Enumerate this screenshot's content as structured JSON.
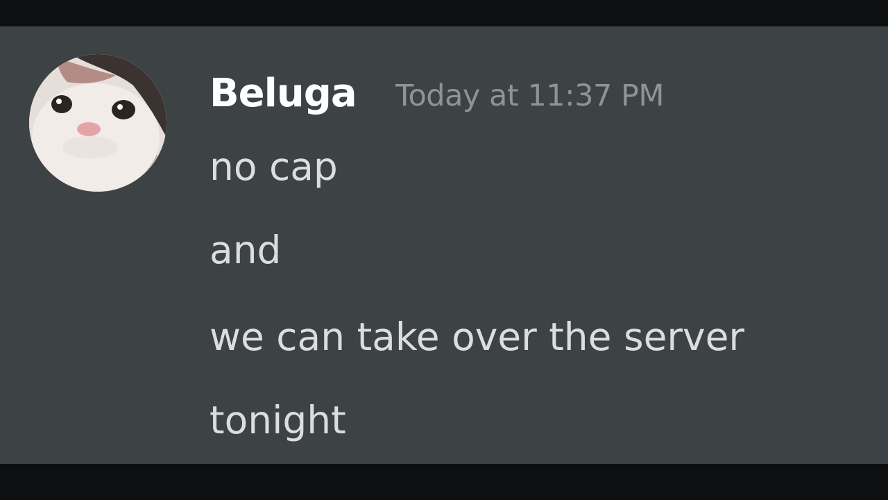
{
  "message": {
    "author": "Beluga",
    "timestamp": "Today at 11:37 PM",
    "lines": [
      "no cap",
      "and",
      "we can take over the server",
      "tonight"
    ]
  },
  "avatar": {
    "icon": "cat-face-avatar"
  },
  "colors": {
    "chat_background": "#3d4245",
    "letterbox": "#0e0f10",
    "author_text": "#ffffff",
    "timestamp_text": "#8d9396",
    "message_text": "#dcddde"
  }
}
